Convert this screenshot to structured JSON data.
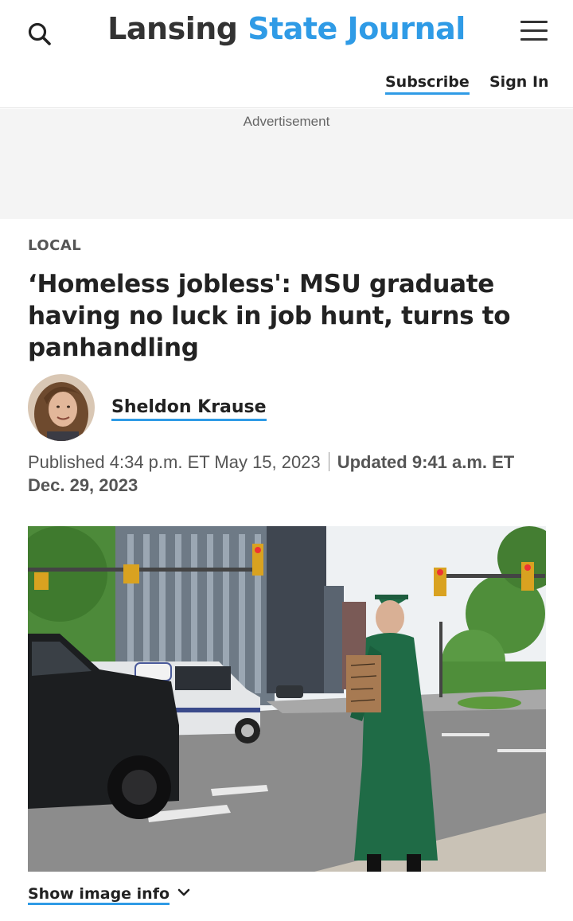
{
  "header": {
    "logo_part1": "Lansing",
    "logo_part2": "State Journal",
    "subscribe_label": "Subscribe",
    "signin_label": "Sign In",
    "search_icon": "search-icon",
    "menu_icon": "hamburger-menu-icon"
  },
  "ad": {
    "label": "Advertisement"
  },
  "article": {
    "section": "LOCAL",
    "headline": "‘Homeless jobless': MSU graduate having no luck in job hunt, turns to panhandling",
    "author": "Sheldon Krause",
    "published": "Published 4:34 p.m. ET May 15, 2023",
    "updated": "Updated 9:41 a.m. ET Dec. 29, 2023",
    "show_image_info": "Show image info"
  },
  "colors": {
    "brand_blue": "#2f9be6",
    "text_dark": "#222222",
    "text_muted": "#555555",
    "gown_green": "#1f6b46"
  }
}
